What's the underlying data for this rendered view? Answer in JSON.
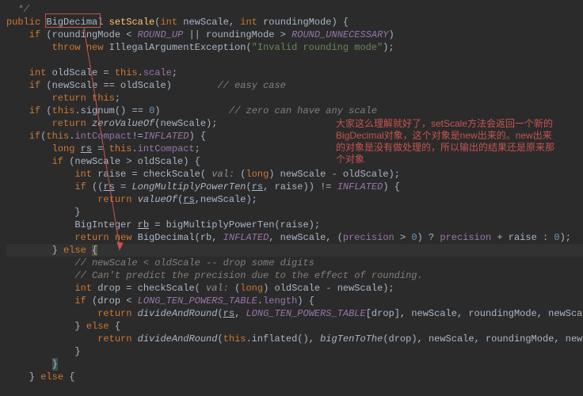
{
  "lines": {
    "l0": "  */",
    "l1a": "public ",
    "l1b": "BigDecimal",
    "l1c": " ",
    "l1d": "setScale",
    "l1e": "(",
    "l1f": "int ",
    "l1g": "newScale, ",
    "l1h": "int ",
    "l1i": "roundingMode) {",
    "l2a": "    if ",
    "l2b": "(roundingMode < ",
    "l2c": "ROUND_UP",
    "l2d": " || roundingMode > ",
    "l2e": "ROUND_UNNECESSARY",
    "l2f": ")",
    "l3a": "        throw new ",
    "l3b": "IllegalArgumentException(",
    "l3c": "\"Invalid rounding mode\"",
    "l3d": ");",
    "l5a": "    int ",
    "l5b": "oldScale = ",
    "l5c": "this",
    "l5d": ".",
    "l5e": "scale",
    "l5f": ";",
    "l6a": "    if ",
    "l6b": "(newScale == oldScale)        ",
    "l6c": "// easy case",
    "l7a": "        return this",
    "l7b": ";",
    "l8a": "    if ",
    "l8b": "(",
    "l8c": "this",
    "l8d": ".signum() == ",
    "l8e": "0",
    "l8f": ")            ",
    "l8g": "// zero can have any scale",
    "l9a": "        return ",
    "l9b": "zeroValueOf",
    "l9c": "(newScale);",
    "l10a": "    if",
    "l10b": "(",
    "l10c": "this",
    "l10d": ".",
    "l10e": "intCompact",
    "l10f": "!=",
    "l10g": "INFLATED",
    "l10h": ") {",
    "l11a": "        long ",
    "l11b": "rs",
    "l11c": " = ",
    "l11d": "this",
    "l11e": ".",
    "l11f": "intCompact",
    "l11g": ";",
    "l12a": "        if ",
    "l12b": "(newScale > oldScale) {",
    "l13a": "            int ",
    "l13b": "raise = checkScale( ",
    "l13c": "val: ",
    "l13d": "(",
    "l13e": "long",
    "l13f": ") newScale - oldScale);",
    "l14a": "            if ",
    "l14b": "((",
    "l14c": "rs",
    "l14d": " = ",
    "l14e": "LongMultiplyPowerTen",
    "l14f": "(",
    "l14g": "rs",
    "l14h": ", raise)) != ",
    "l14i": "INFLATED",
    "l14j": ") {",
    "l15a": "                return ",
    "l15b": "valueOf",
    "l15c": "(",
    "l15d": "rs",
    "l15e": ",newScale);",
    "l16a": "            }",
    "l17a": "            BigInteger ",
    "l17b": "rb",
    "l17c": " = bigMultiplyPowerTen(raise);",
    "l18a": "            return new ",
    "l18b": "BigDecimal(rb, ",
    "l18c": "INFLATED",
    "l18d": ", newScale, (",
    "l18e": "precision",
    "l18f": " > ",
    "l18g": "0",
    "l18h": ") ? ",
    "l18i": "precision",
    "l18j": " + raise : ",
    "l18k": "0",
    "l18l": ");",
    "l19a": "        } ",
    "l19b": "else ",
    "l19c": "{",
    "l20a": "            // newScale < oldScale -- drop some digits",
    "l21a": "            // Can't predict the precision due to the effect of rounding.",
    "l22a": "            int ",
    "l22b": "drop = checkScale( ",
    "l22c": "val: ",
    "l22d": "(",
    "l22e": "long",
    "l22f": ") oldScale - newScale);",
    "l23a": "            if ",
    "l23b": "(drop < ",
    "l23c": "LONG_TEN_POWERS_TABLE",
    "l23d": ".",
    "l23e": "length",
    "l23f": ") {",
    "l24a": "                return ",
    "l24b": "divideAndRound",
    "l24c": "(",
    "l24d": "rs",
    "l24e": ", ",
    "l24f": "LONG_TEN_POWERS_TABLE",
    "l24g": "[drop], newScale, roundingMode, newScale);",
    "l25a": "            } ",
    "l25b": "else ",
    "l25c": "{",
    "l26a": "                return ",
    "l26b": "divideAndRound",
    "l26c": "(",
    "l26d": "this",
    "l26e": ".inflated(), ",
    "l26f": "bigTenToThe",
    "l26g": "(drop), newScale, roundingMode, newScale);",
    "l27a": "            }",
    "l28a": "        ",
    "l28b": "}",
    "l29a": "    } ",
    "l29b": "else ",
    "l29c": "{"
  },
  "annotation": {
    "t1": "大家这么理解就好了，setScale方法会返回一个新的",
    "t2": "BigDecimal对象，这个对象是new出来的。new出来",
    "t3": "的对象是没有做处理的，所以输出的结果还是原来那",
    "t4": "个对象"
  }
}
